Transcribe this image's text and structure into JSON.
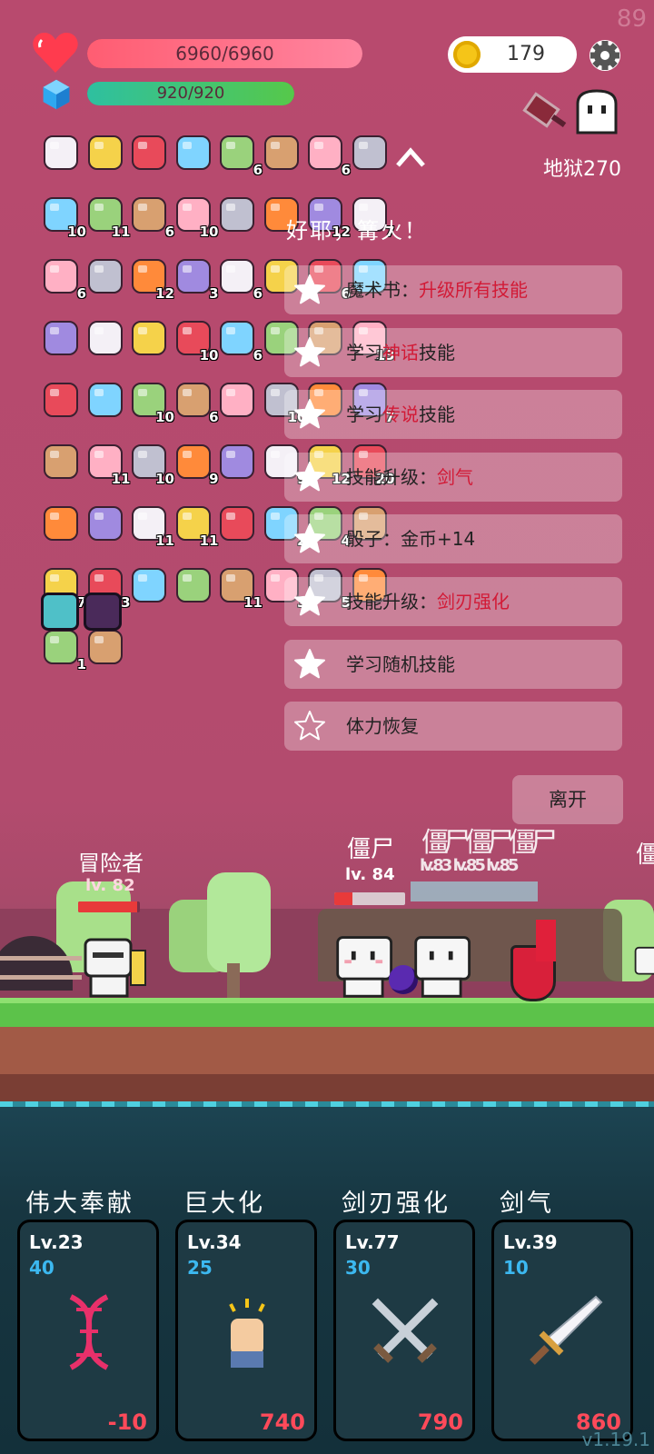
{
  "status": {
    "fps": "89",
    "hp_text": "6960/6960",
    "hp_fraction": 1.0,
    "energy_text": "920/920",
    "energy_fraction": 1.0,
    "coins": "179",
    "level_label": "地狱270"
  },
  "inventory": {
    "rows": [
      [
        {
          "icon": "scroll-bow-icon",
          "count": ""
        },
        {
          "icon": "scroll-bow-icon",
          "count": ""
        },
        {
          "icon": "biohazard-icon",
          "count": ""
        },
        {
          "icon": "scroll-bow-icon",
          "count": ""
        },
        {
          "icon": "tombstone-icon",
          "count": "6"
        },
        {
          "icon": "robe-icon",
          "count": ""
        },
        {
          "icon": "cash-heart-icon",
          "count": "6"
        },
        {
          "icon": "menu-book-icon",
          "count": ""
        }
      ],
      [
        {
          "icon": "apple-icon",
          "count": "10"
        },
        {
          "icon": "ghost-icon",
          "count": "11"
        },
        {
          "icon": "sunflower-icon",
          "count": "6"
        },
        {
          "icon": "meteor-icon",
          "count": "10"
        },
        {
          "icon": "map-pencil-icon",
          "count": ""
        },
        {
          "icon": "sword-icon",
          "count": ""
        },
        {
          "icon": "flower-icon",
          "count": "12"
        },
        {
          "icon": "envelope-icon",
          "count": "7"
        }
      ],
      [
        {
          "icon": "axe-icon",
          "count": "6"
        },
        {
          "icon": "ring-icon",
          "count": ""
        },
        {
          "icon": "disc-icon",
          "count": "12"
        },
        {
          "icon": "scroll-icon",
          "count": "3"
        },
        {
          "icon": "coins-icon",
          "count": "6"
        },
        {
          "icon": "crown-icon",
          "count": ""
        },
        {
          "icon": "daisy-icon",
          "count": "6"
        },
        {
          "icon": "crown-jewel-icon",
          "count": ""
        }
      ],
      [
        {
          "icon": "viking-helmet-icon",
          "count": ""
        },
        {
          "icon": "card-star-icon",
          "count": ""
        },
        {
          "icon": "network-icon",
          "count": ""
        },
        {
          "icon": "donut-icon",
          "count": "10"
        },
        {
          "icon": "strawberry-icon",
          "count": "6"
        },
        {
          "icon": "beer-icon",
          "count": ""
        },
        {
          "icon": "star-icon",
          "count": ""
        },
        {
          "icon": "pirate-chest-icon",
          "count": "13"
        }
      ],
      [
        {
          "icon": "pineapple-icon",
          "count": ""
        },
        {
          "icon": "melon-icon",
          "count": ""
        },
        {
          "icon": "book-icon",
          "count": "10"
        },
        {
          "icon": "potion-flask-icon",
          "count": "6"
        },
        {
          "icon": "target-icon",
          "count": ""
        },
        {
          "icon": "watermelon-icon",
          "count": "10"
        },
        {
          "icon": "crossed-swords-icon",
          "count": ""
        },
        {
          "icon": "syringe-icon",
          "count": "7"
        }
      ],
      [
        {
          "icon": "playing-card-icon",
          "count": ""
        },
        {
          "icon": "pill-icon",
          "count": "11"
        },
        {
          "icon": "blade-icon",
          "count": "10"
        },
        {
          "icon": "pudding-flag-icon",
          "count": "9"
        },
        {
          "icon": "sundae-icon",
          "count": ""
        },
        {
          "icon": "steak-icon",
          "count": "9"
        },
        {
          "icon": "heart-icon",
          "count": "12"
        },
        {
          "icon": "map-scroll-icon",
          "count": "20"
        }
      ],
      [
        {
          "icon": "mushroom-icon",
          "count": ""
        },
        {
          "icon": "sun-icon",
          "count": ""
        },
        {
          "icon": "spiked-ball-icon",
          "count": "11"
        },
        {
          "icon": "sock-icon",
          "count": "11"
        },
        {
          "icon": "treasure-map-icon",
          "count": ""
        },
        {
          "icon": "briefcase-icon",
          "count": "2"
        },
        {
          "icon": "red-card-icon",
          "count": "4"
        },
        {
          "icon": "ruby-icon",
          "count": ""
        }
      ],
      [
        {
          "icon": "spray-bottle-icon",
          "count": "7"
        },
        {
          "icon": "coconut-icon",
          "count": "3"
        },
        {
          "icon": "fire-spirit-icon",
          "count": ""
        },
        {
          "icon": "chain-dots-icon",
          "count": ""
        },
        {
          "icon": "tea-bag-icon",
          "count": "11"
        },
        {
          "icon": "dice-icon",
          "count": "3"
        },
        {
          "icon": "jam-jar-icon",
          "count": "5"
        },
        {
          "icon": "safety-pin-icon",
          "count": ""
        }
      ],
      [
        {
          "icon": "bread-icon",
          "count": "1"
        },
        {
          "icon": "hook-icon",
          "count": ""
        }
      ]
    ],
    "specials": [
      {
        "icon": "light-bulb-tile-icon"
      },
      {
        "icon": "demon-tile-icon"
      }
    ]
  },
  "dialog": {
    "title": "好耶，篝火！",
    "options": [
      {
        "pre": "魔术书：",
        "hl": "升级所有技能",
        "post": "",
        "star": "filled"
      },
      {
        "pre": "学习",
        "hl": "神话",
        "post": "技能",
        "star": "filled"
      },
      {
        "pre": "学习",
        "hl": "传说",
        "post": "技能",
        "star": "filled"
      },
      {
        "pre": "技能升级：",
        "hl": "剑气",
        "post": "",
        "star": "filled"
      },
      {
        "pre": "骰子：金币+14",
        "hl": "",
        "post": "",
        "star": "filled"
      },
      {
        "pre": "技能升级：",
        "hl": "剑刃强化",
        "post": "",
        "star": "filled"
      },
      {
        "pre": "学习随机技能",
        "hl": "",
        "post": "",
        "star": "filled"
      },
      {
        "pre": "体力恢复",
        "hl": "",
        "post": "",
        "star": "outline"
      }
    ],
    "leave": "离开"
  },
  "battle": {
    "player": {
      "name": "冒险者",
      "level": "lv. 82",
      "hp_fraction": 0.95
    },
    "enemy_main": {
      "name": "僵尸",
      "level": "lv. 84",
      "hp_fraction": 0.25
    },
    "enemy_stack_names": "僵尸僵尸僵尸",
    "enemy_stack_levels": "lv.83 lv.85 lv.85",
    "enemy_edge_name": "僵"
  },
  "skills": [
    {
      "title": "伟大奉献",
      "level": "Lv.23",
      "cost": "40",
      "value": "-10",
      "icon": "dna-icon"
    },
    {
      "title": "巨大化",
      "level": "Lv.34",
      "cost": "25",
      "value": "740",
      "icon": "fist-icon"
    },
    {
      "title": "剑刃强化",
      "level": "Lv.77",
      "cost": "30",
      "value": "790",
      "icon": "crossed-swords-icon"
    },
    {
      "title": "剑气",
      "level": "Lv.39",
      "cost": "10",
      "value": "860",
      "icon": "sword-icon"
    }
  ],
  "version": "v1.19.1",
  "colors": {
    "bg": "#b34b6e",
    "hp": "#ff6f86",
    "energy": "#3cc28a",
    "highlight": "#d21a36",
    "skill_cost": "#3cb8f0",
    "skill_value": "#ff4a5a"
  }
}
